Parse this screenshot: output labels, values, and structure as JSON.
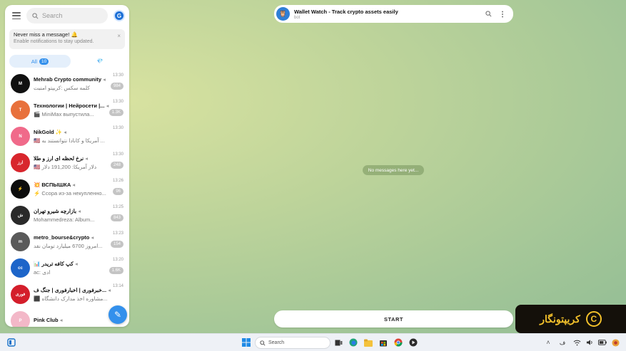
{
  "sidebar": {
    "search_placeholder": "Search",
    "logo_letter": "G",
    "notification": {
      "title": "Never miss a message! 🔔",
      "subtitle": "Enable notifications to stay updated.",
      "close": "×"
    },
    "tabs": {
      "all_label": "All",
      "all_count": "10",
      "gem_icon": "💎"
    },
    "chats": [
      {
        "name": "Mehrab Crypto community",
        "preview": "کلمه سکس :کریپتو امنیت",
        "time": "13:30",
        "badge": "984",
        "avatar_color": "#111111",
        "avatar_text": "M"
      },
      {
        "name": "Технологии | Нейросети |...",
        "preview": "🎬 MiniMax выпустила...",
        "time": "13:30",
        "badge": "1.3K",
        "avatar_color": "#e8713c",
        "avatar_text": "T"
      },
      {
        "name": "NikGold ✨",
        "preview": "🇺🇸 آمریکا و کانادا نتوانستند به ...",
        "time": "13:30",
        "badge": "",
        "avatar_color": "#f06a8a",
        "avatar_text": "N"
      },
      {
        "name": "نرخ لحظه ای ارز و طلا",
        "preview": "🇺🇸 دلار آمریکا: 191,200 دلار",
        "time": "13:30",
        "badge": "248",
        "avatar_color": "#d8262d",
        "avatar_text": "ارز"
      },
      {
        "name": "💥 ВСПЫШКА",
        "preview": "⚡ Ссора из-за некупленно...",
        "time": "13:26",
        "badge": "96",
        "avatar_color": "#0d0d0d",
        "avatar_text": "⚡"
      },
      {
        "name": "بازارچه شیرو تهران",
        "preview": "Mohammedreza: Album...",
        "time": "13:25",
        "badge": "843",
        "avatar_color": "#2a2a2a",
        "avatar_text": "ش"
      },
      {
        "name": "metro_bourse&crypto",
        "preview": "امروز 6700 میلیارد تومان نقد...",
        "time": "13:23",
        "badge": "154",
        "avatar_color": "#5a5a5a",
        "avatar_text": "m"
      },
      {
        "name": "📊 کپ کافه تریدر",
        "preview": "ac: ادی",
        "time": "13:20",
        "badge": "1.6K",
        "avatar_color": "#1d65c9",
        "avatar_text": "cc"
      },
      {
        "name": "خبرفوری | اخبارفوری | جنگ ف...",
        "preview": "⬛ مشاوره اخذ مدارک دانشگاه...",
        "time": "13:14",
        "badge": "",
        "avatar_color": "#d41e2b",
        "avatar_text": "فوری"
      },
      {
        "name": "Pink Club",
        "preview": "",
        "time": "",
        "badge": "",
        "avatar_color": "#f3b8c8",
        "avatar_text": "P"
      }
    ],
    "fab_icon": "✎"
  },
  "chat": {
    "title": "Wallet Watch - Track crypto assets easily",
    "subtitle": "bot",
    "empty_text": "No messages here yet...",
    "start_label": "START"
  },
  "watermark": {
    "text": "کریپتونگار",
    "logo": "C"
  },
  "taskbar": {
    "search_label": "Search"
  },
  "colors": {
    "accent": "#3390ec",
    "watermark_gold": "#f3c12b"
  }
}
